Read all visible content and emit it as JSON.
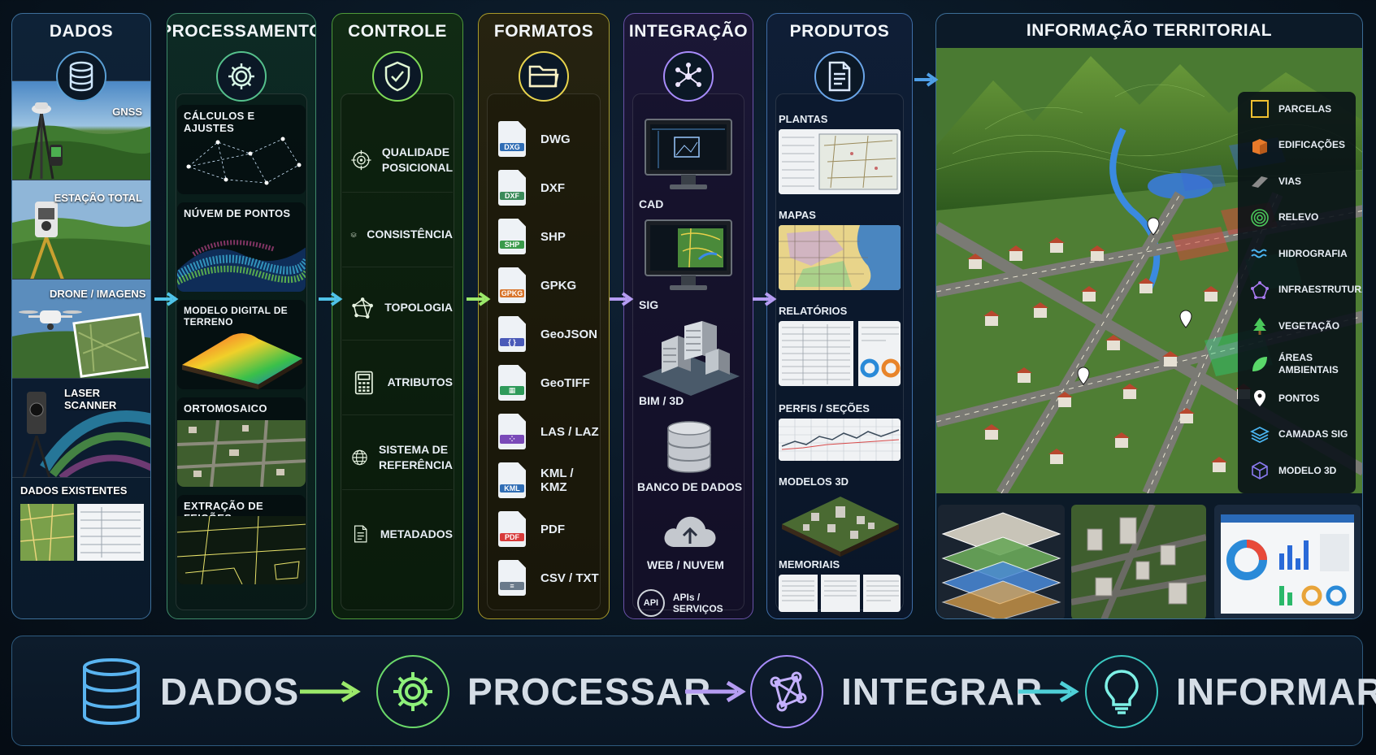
{
  "panels": {
    "dados": {
      "title": "DADOS",
      "items": [
        "GNSS",
        "ESTAÇÃO TOTAL",
        "DRONE / IMAGENS",
        "LASER SCANNER",
        "DADOS EXISTENTES"
      ]
    },
    "processamento": {
      "title": "PROCESSAMENTO",
      "items": [
        "CÁLCULOS E AJUSTES",
        "NÚVEM DE PONTOS",
        "MODELO DIGITAL DE TERRENO",
        "ORTOMOSAICO",
        "EXTRAÇÃO DE FEIÇÕES"
      ]
    },
    "controle": {
      "title": "CONTROLE",
      "items": [
        {
          "line1": "QUALIDADE",
          "line2": "POSICIONAL"
        },
        {
          "line1": "CONSISTÊNCIA",
          "line2": ""
        },
        {
          "line1": "TOPOLOGIA",
          "line2": ""
        },
        {
          "line1": "ATRIBUTOS",
          "line2": ""
        },
        {
          "line1": "SISTEMA DE",
          "line2": "REFERÊNCIA"
        },
        {
          "line1": "METADADOS",
          "line2": ""
        }
      ]
    },
    "formatos": {
      "title": "FORMATOS",
      "items": [
        {
          "label": "DWG",
          "tag": "DXG",
          "color": "#2f6db5"
        },
        {
          "label": "DXF",
          "tag": "DXF",
          "color": "#3a8a5a"
        },
        {
          "label": "SHP",
          "tag": "SHP",
          "color": "#3a9a4a"
        },
        {
          "label": "GPKG",
          "tag": "GPKG",
          "color": "#d8742a"
        },
        {
          "label": "GeoJSON",
          "tag": "{ }",
          "color": "#4a5ab8"
        },
        {
          "label": "GeoTIFF",
          "tag": "▦",
          "color": "#2e9a5a"
        },
        {
          "label": "LAS / LAZ",
          "tag": "⁘",
          "color": "#7a4ab8"
        },
        {
          "label": "KML / KMZ",
          "tag": "KML",
          "color": "#2f6db5"
        },
        {
          "label": "PDF",
          "tag": "PDF",
          "color": "#d83a3a"
        },
        {
          "label": "CSV / TXT",
          "tag": "≡",
          "color": "#6a7a8a"
        }
      ]
    },
    "integracao": {
      "title": "INTEGRAÇÃO",
      "items": [
        "CAD",
        "SIG",
        "BIM / 3D",
        "BANCO DE DADOS",
        "WEB / NUVEM"
      ],
      "api_badge": "API",
      "api_label": "APIs / SERVIÇOS"
    },
    "produtos": {
      "title": "PRODUTOS",
      "items": [
        "PLANTAS",
        "MAPAS",
        "RELATÓRIOS",
        "PERFIS / SEÇÕES",
        "MODELOS 3D",
        "MEMORIAIS"
      ]
    },
    "informacao": {
      "title": "INFORMAÇÃO TERRITORIAL",
      "legend": [
        {
          "label": "PARCELAS",
          "icon": "parcel-icon"
        },
        {
          "label": "EDIFICAÇÕES",
          "icon": "building-icon"
        },
        {
          "label": "VIAS",
          "icon": "road-icon"
        },
        {
          "label": "RELEVO",
          "icon": "contour-icon"
        },
        {
          "label": "HIDROGRAFIA",
          "icon": "water-icon"
        },
        {
          "label": "INFRAESTRUTURA",
          "icon": "network-icon"
        },
        {
          "label": "VEGETAÇÃO",
          "icon": "tree-icon"
        },
        {
          "label": "ÁREAS AMBIENTAIS",
          "icon": "leaf-icon"
        },
        {
          "label": "PONTOS",
          "icon": "pin-icon"
        },
        {
          "label": "CAMADAS SIG",
          "icon": "layers-icon"
        },
        {
          "label": "MODELO 3D",
          "icon": "cube-icon"
        }
      ]
    }
  },
  "flow": [
    "DADOS",
    "PROCESSAR",
    "INTEGRAR",
    "INFORMAR"
  ],
  "colors": {
    "dados": "#5a9fd4",
    "processamento": "#55c08c",
    "controle": "#7ed957",
    "formatos": "#e8d44d",
    "integracao": "#a78bfa",
    "produtos": "#6aa5e8",
    "arrow_cyan": "#4fc3e8",
    "arrow_green": "#9be86a",
    "arrow_purple": "#b59cf2"
  }
}
